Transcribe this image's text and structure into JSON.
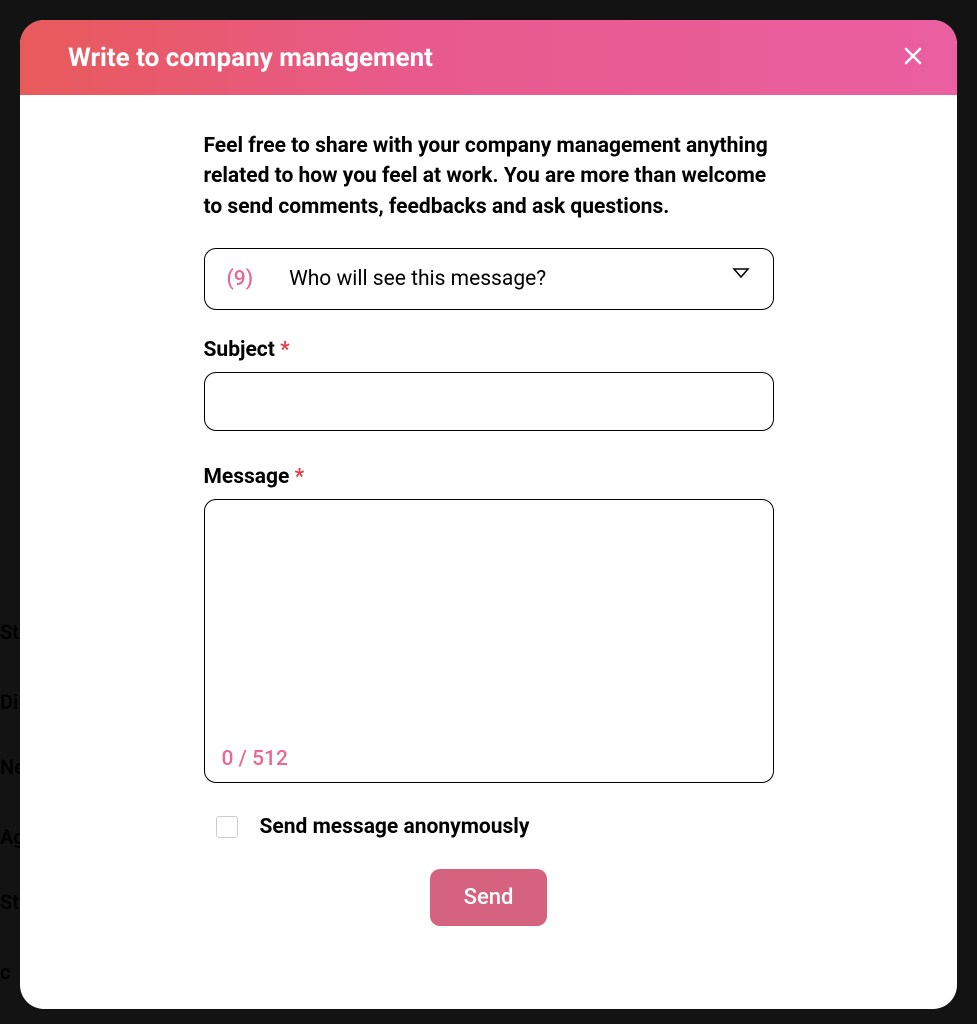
{
  "modal": {
    "title": "Write to company management",
    "intro": "Feel free to share with your company management anything related to how you feel at work. You are more than welcome to send comments, feedbacks and ask questions.",
    "recipients": {
      "count": "(9)",
      "label": "Who will see this message?"
    },
    "fields": {
      "subject": {
        "label": "Subject",
        "value": ""
      },
      "message": {
        "label": "Message",
        "value": "",
        "counter": "0 / 512",
        "maxlength": "512"
      },
      "anonymous": {
        "label": "Send message anonymously",
        "checked": false
      }
    },
    "required_mark": "*",
    "submit_label": "Send"
  },
  "background": {
    "hints": [
      "St",
      "Di",
      "Ne",
      "Ag",
      "St",
      "c"
    ]
  }
}
